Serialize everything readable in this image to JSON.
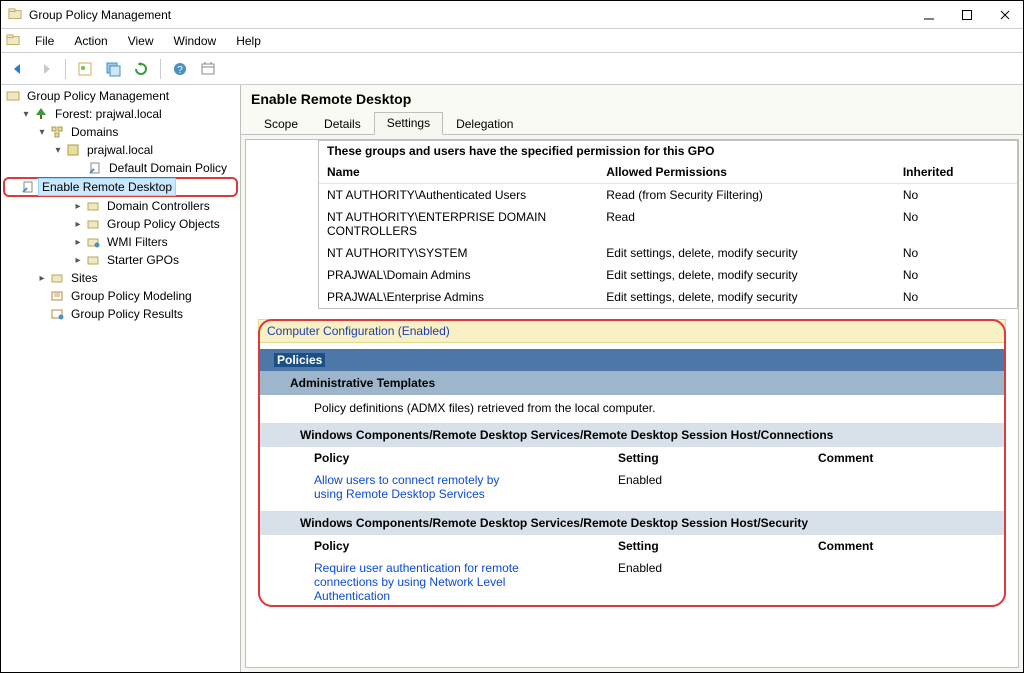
{
  "app": {
    "title": "Group Policy Management"
  },
  "menu": {
    "file": "File",
    "action": "Action",
    "view": "View",
    "window": "Window",
    "help": "Help"
  },
  "tree": {
    "root": "Group Policy Management",
    "forest": "Forest: prajwal.local",
    "domains": "Domains",
    "domain_name": "prajwal.local",
    "default_policy": "Default Domain Policy",
    "enable_rd": "Enable Remote Desktop",
    "domain_controllers": "Domain Controllers",
    "gpo": "Group Policy Objects",
    "wmi": "WMI Filters",
    "starter": "Starter GPOs",
    "sites": "Sites",
    "modeling": "Group Policy Modeling",
    "results": "Group Policy Results"
  },
  "content": {
    "title": "Enable Remote Desktop",
    "tabs": {
      "scope": "Scope",
      "details": "Details",
      "settings": "Settings",
      "delegation": "Delegation"
    }
  },
  "perm": {
    "title": "These groups and users have the specified permission for this GPO",
    "header_name": "Name",
    "header_perm": "Allowed Permissions",
    "header_inherited": "Inherited",
    "rows": [
      {
        "name": "NT AUTHORITY\\Authenticated Users",
        "perm": "Read (from Security Filtering)",
        "inh": "No"
      },
      {
        "name": "NT AUTHORITY\\ENTERPRISE DOMAIN CONTROLLERS",
        "perm": "Read",
        "inh": "No"
      },
      {
        "name": "NT AUTHORITY\\SYSTEM",
        "perm": "Edit settings, delete, modify security",
        "inh": "No"
      },
      {
        "name": "PRAJWAL\\Domain Admins",
        "perm": "Edit settings, delete, modify security",
        "inh": "No"
      },
      {
        "name": "PRAJWAL\\Enterprise Admins",
        "perm": "Edit settings, delete, modify security",
        "inh": "No"
      }
    ]
  },
  "config": {
    "cc_enabled": "Computer Configuration (Enabled)",
    "policies": "Policies",
    "admin_templates": "Administrative Templates",
    "admin_note": "Policy definitions (ADMX files) retrieved from the local computer.",
    "path1": "Windows Components/Remote Desktop Services/Remote Desktop Session Host/Connections",
    "path2": "Windows Components/Remote Desktop Services/Remote Desktop Session Host/Security",
    "col_policy": "Policy",
    "col_setting": "Setting",
    "col_comment": "Comment",
    "policy1_name": "Allow users to connect remotely by using Remote Desktop Services",
    "policy1_setting": "Enabled",
    "policy2_name": "Require user authentication for remote connections by using Network Level Authentication",
    "policy2_setting": "Enabled"
  }
}
